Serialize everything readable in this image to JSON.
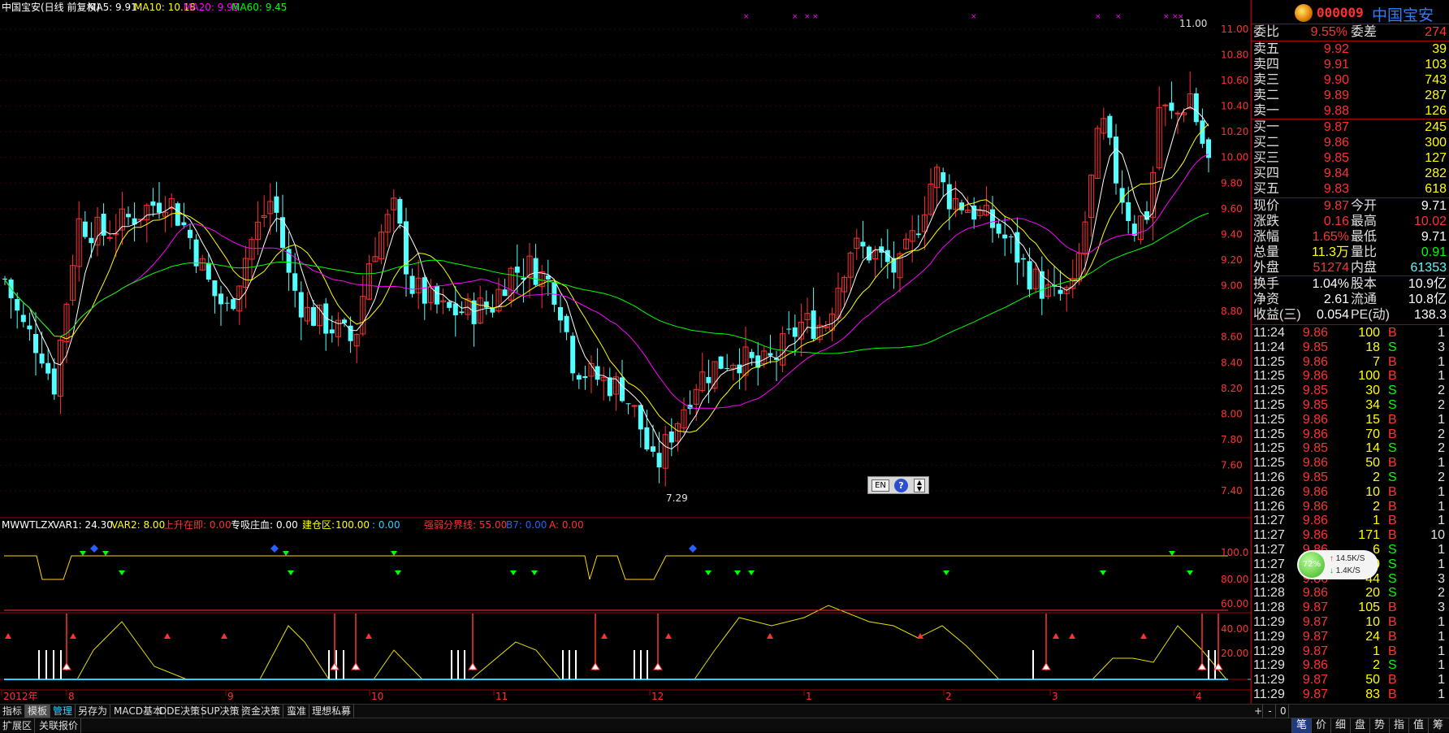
{
  "colors": {
    "up": "#ff3232",
    "down": "#54ffff",
    "ma5": "#ffffff",
    "ma10": "#ffff00",
    "ma20": "#ff00ff",
    "ma60": "#00ff00",
    "grid": "#a00000",
    "axis_text": "#ff3232"
  },
  "header": {
    "title": "中国宝安(日线 前复权)",
    "ma5_label": "MA5: 9.91",
    "ma10_label": "MA10: 10.18",
    "ma20_label": "MA20: 9.95",
    "ma60_label": "MA60: 9.45"
  },
  "indicator": {
    "name": "MWWTLZX",
    "var1": "VAR1: 24.30",
    "var2": "VAR2: 8.00",
    "rise": "上升在即: 0.00",
    "absorb_label": "专吸庄血:",
    "absorb_value": "0.00",
    "build_label": "建仓区:",
    "build_value": "100.00",
    "build_value2": ": 0.00",
    "strength": "强弱分界线: 55.00",
    "b7": "B7: 0.00",
    "a": "A: 0.00",
    "axis_ticks": [
      "100.0",
      "80.00",
      "60.00",
      "40.00",
      "20.00"
    ]
  },
  "chart_data": {
    "type": "candlestick",
    "y_ticks": [
      "11.00",
      "10.80",
      "10.60",
      "10.40",
      "10.20",
      "10.00",
      "9.80",
      "9.60",
      "9.40",
      "9.20",
      "9.00",
      "8.80",
      "8.60",
      "8.40",
      "8.20",
      "8.00",
      "7.80",
      "7.60",
      "7.40"
    ],
    "ylim": [
      7.3,
      11.1
    ],
    "x_ticks": [
      "2012年",
      "8",
      "9",
      "10",
      "11",
      "12",
      "1",
      "2",
      "3",
      "4"
    ],
    "annotation_high": "11.00",
    "annotation_low": "7.29",
    "period_label": "日线"
  },
  "quote": {
    "code": "000009",
    "name": "中国宝安",
    "weibi_label": "委比",
    "weibi_value": "9.55%",
    "weicha_label": "委差",
    "weicha_value": "274",
    "asks": [
      {
        "label": "卖五",
        "price": "9.92",
        "vol": "39"
      },
      {
        "label": "卖四",
        "price": "9.91",
        "vol": "103"
      },
      {
        "label": "卖三",
        "price": "9.90",
        "vol": "743"
      },
      {
        "label": "卖二",
        "price": "9.89",
        "vol": "287"
      },
      {
        "label": "卖一",
        "price": "9.88",
        "vol": "126"
      }
    ],
    "bids": [
      {
        "label": "买一",
        "price": "9.87",
        "vol": "245"
      },
      {
        "label": "买二",
        "price": "9.86",
        "vol": "300"
      },
      {
        "label": "买三",
        "price": "9.85",
        "vol": "127"
      },
      {
        "label": "买四",
        "price": "9.84",
        "vol": "282"
      },
      {
        "label": "买五",
        "price": "9.83",
        "vol": "618"
      }
    ],
    "stats1": [
      {
        "l1": "现价",
        "v1": "9.87",
        "l2": "今开",
        "v2": "9.71"
      },
      {
        "l1": "涨跌",
        "v1": "0.16",
        "l2": "最高",
        "v2": "10.02"
      },
      {
        "l1": "涨幅",
        "v1": "1.65%",
        "l2": "最低",
        "v2": "9.71"
      },
      {
        "l1": "总量",
        "v1": "11.3万",
        "l2": "量比",
        "v2": "0.91"
      },
      {
        "l1": "外盘",
        "v1": "51274",
        "l2": "内盘",
        "v2": "61353"
      }
    ],
    "stats2": [
      {
        "l1": "换手",
        "v1": "1.04%",
        "l2": "股本",
        "v2": "10.9亿"
      },
      {
        "l1": "净资",
        "v1": "2.61",
        "l2": "流通",
        "v2": "10.8亿"
      },
      {
        "l1": "收益(三)",
        "v1": "0.054",
        "l2": "PE(动)",
        "v2": "138.3"
      }
    ],
    "ticks": [
      {
        "t": "11:24",
        "p": "9.86",
        "v": "100",
        "d": "B",
        "n": "1"
      },
      {
        "t": "11:24",
        "p": "9.85",
        "v": "18",
        "d": "S",
        "n": "3"
      },
      {
        "t": "11:25",
        "p": "9.86",
        "v": "7",
        "d": "B",
        "n": "1"
      },
      {
        "t": "11:25",
        "p": "9.86",
        "v": "100",
        "d": "B",
        "n": "1"
      },
      {
        "t": "11:25",
        "p": "9.85",
        "v": "30",
        "d": "S",
        "n": "2"
      },
      {
        "t": "11:25",
        "p": "9.85",
        "v": "34",
        "d": "S",
        "n": "2"
      },
      {
        "t": "11:25",
        "p": "9.86",
        "v": "15",
        "d": "B",
        "n": "1"
      },
      {
        "t": "11:25",
        "p": "9.86",
        "v": "70",
        "d": "B",
        "n": "2"
      },
      {
        "t": "11:25",
        "p": "9.85",
        "v": "14",
        "d": "S",
        "n": "2"
      },
      {
        "t": "11:25",
        "p": "9.86",
        "v": "50",
        "d": "B",
        "n": "1"
      },
      {
        "t": "11:26",
        "p": "9.85",
        "v": "2",
        "d": "S",
        "n": "2"
      },
      {
        "t": "11:26",
        "p": "9.86",
        "v": "10",
        "d": "B",
        "n": "1"
      },
      {
        "t": "11:26",
        "p": "9.86",
        "v": "2",
        "d": "B",
        "n": "1"
      },
      {
        "t": "11:27",
        "p": "9.86",
        "v": "1",
        "d": "B",
        "n": "1"
      },
      {
        "t": "11:27",
        "p": "9.86",
        "v": "171",
        "d": "B",
        "n": "10"
      },
      {
        "t": "11:27",
        "p": "9.86",
        "v": "6",
        "d": "S",
        "n": "1"
      },
      {
        "t": "11:27",
        "p": "9.85",
        "v": "10",
        "d": "S",
        "n": "1"
      },
      {
        "t": "11:28",
        "p": "9.86",
        "v": "44",
        "d": "S",
        "n": "3"
      },
      {
        "t": "11:28",
        "p": "9.86",
        "v": "20",
        "d": "S",
        "n": "2"
      },
      {
        "t": "11:28",
        "p": "9.87",
        "v": "105",
        "d": "B",
        "n": "3"
      },
      {
        "t": "11:29",
        "p": "9.87",
        "v": "10",
        "d": "B",
        "n": "1"
      },
      {
        "t": "11:29",
        "p": "9.87",
        "v": "24",
        "d": "B",
        "n": "1"
      },
      {
        "t": "11:29",
        "p": "9.87",
        "v": "1",
        "d": "B",
        "n": "1"
      },
      {
        "t": "11:29",
        "p": "9.86",
        "v": "2",
        "d": "S",
        "n": "1"
      },
      {
        "t": "11:29",
        "p": "9.87",
        "v": "50",
        "d": "B",
        "n": "1"
      },
      {
        "t": "11:29",
        "p": "9.87",
        "v": "83",
        "d": "B",
        "n": "1"
      }
    ]
  },
  "network_badge": {
    "percent": "72%",
    "up": "14.5K/S",
    "down": "1.4K/S"
  },
  "ime": {
    "lang": "EN",
    "help": "?"
  },
  "toolbar": {
    "tabs": [
      "指标",
      "模板",
      "管理",
      "另存为",
      "MACD基本",
      "DDE决策",
      "SUP决策",
      "资金决策",
      "蛮准",
      "理想私募"
    ],
    "right_controls": [
      "+",
      "-",
      "0"
    ]
  },
  "statusbar": {
    "left": [
      "扩展区",
      "关联报价"
    ],
    "tabs": [
      "笔",
      "价",
      "细",
      "盘",
      "势",
      "指",
      "值",
      "筹"
    ]
  }
}
